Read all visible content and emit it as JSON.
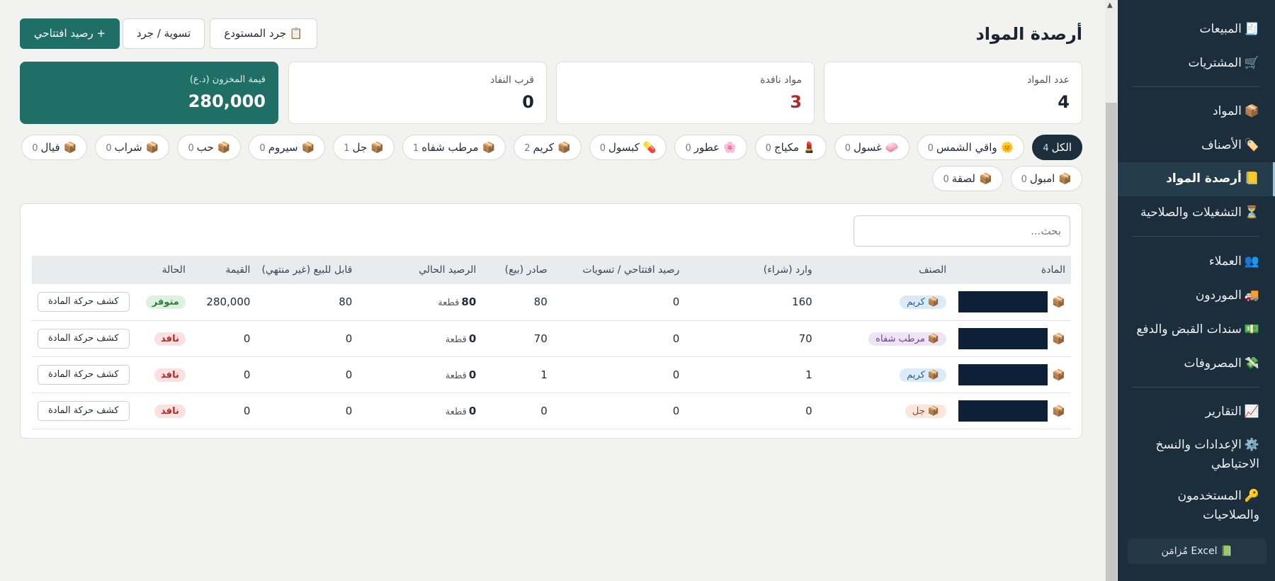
{
  "header": {
    "title": "أرصدة المواد",
    "buttons": {
      "warehouse_count": "📋 جرد المستودع",
      "settlement": "تسوية / جرد",
      "opening_balance": "+ رصيد افتتاحي"
    }
  },
  "stats": [
    {
      "label": "عدد المواد",
      "value": "4"
    },
    {
      "label": "مواد نافدة",
      "value": "3"
    },
    {
      "label": "قرب النفاد",
      "value": "0"
    },
    {
      "label": "قيمة المخزون (د.ع)",
      "value": "280,000"
    }
  ],
  "chips": [
    {
      "icon": "",
      "label": "الكل",
      "count": "4",
      "active": true
    },
    {
      "icon": "🌞",
      "label": "واقي الشمس",
      "count": "0"
    },
    {
      "icon": "🧼",
      "label": "غسول",
      "count": "0"
    },
    {
      "icon": "💄",
      "label": "مكياج",
      "count": "0"
    },
    {
      "icon": "🌸",
      "label": "عطور",
      "count": "0"
    },
    {
      "icon": "💊",
      "label": "كبسول",
      "count": "0"
    },
    {
      "icon": "📦",
      "label": "كريم",
      "count": "2"
    },
    {
      "icon": "📦",
      "label": "مرطب شفاه",
      "count": "1"
    },
    {
      "icon": "📦",
      "label": "جل",
      "count": "1"
    },
    {
      "icon": "📦",
      "label": "سيروم",
      "count": "0"
    },
    {
      "icon": "📦",
      "label": "حب",
      "count": "0"
    },
    {
      "icon": "📦",
      "label": "شراب",
      "count": "0"
    },
    {
      "icon": "📦",
      "label": "فيال",
      "count": "0"
    },
    {
      "icon": "📦",
      "label": "امبول",
      "count": "0"
    },
    {
      "icon": "📦",
      "label": "لصقة",
      "count": "0"
    }
  ],
  "search": {
    "placeholder": "بحث..."
  },
  "table": {
    "columns": [
      "المادة",
      "الصنف",
      "وارد (شراء)",
      "رصيد افتتاحي / تسويات",
      "صادر (بيع)",
      "الرصيد الحالي",
      "قابل للبيع (غير منتهي)",
      "القيمة",
      "الحالة",
      ""
    ],
    "unit": "قطعة",
    "action_label": "كشف حركة المادة",
    "rows": [
      {
        "category": "📦 كريم",
        "cat_color": "#dbeaf7",
        "cat_text": "#2a5d8f",
        "in": "160",
        "opening": "0",
        "out": "80",
        "balance": "80",
        "sellable": "80",
        "value": "280,000",
        "status": "متوفر",
        "status_bg": "#dcf1de",
        "status_fg": "#2e7d3a"
      },
      {
        "category": "📦 مرطب شفاه",
        "cat_color": "#efe3f6",
        "cat_text": "#6b3f8a",
        "in": "70",
        "opening": "0",
        "out": "70",
        "balance": "0",
        "sellable": "0",
        "value": "0",
        "status": "نافد",
        "status_bg": "#fbe0e0",
        "status_fg": "#b0282a"
      },
      {
        "category": "📦 كريم",
        "cat_color": "#dbeaf7",
        "cat_text": "#2a5d8f",
        "in": "1",
        "opening": "0",
        "out": "1",
        "balance": "0",
        "sellable": "0",
        "value": "0",
        "status": "نافد",
        "status_bg": "#fbe0e0",
        "status_fg": "#b0282a"
      },
      {
        "category": "📦 جل",
        "cat_color": "#fbe6dc",
        "cat_text": "#a2441d",
        "in": "0",
        "opening": "0",
        "out": "0",
        "balance": "0",
        "sellable": "0",
        "value": "0",
        "status": "نافد",
        "status_bg": "#fbe0e0",
        "status_fg": "#b0282a"
      }
    ]
  },
  "sidebar": {
    "items": [
      {
        "icon": "🧾",
        "label": "المبيعات"
      },
      {
        "icon": "🛒",
        "label": "المشتريات"
      },
      {
        "icon": "📦",
        "label": "المواد"
      },
      {
        "icon": "🏷️",
        "label": "الأصناف"
      },
      {
        "icon": "📒",
        "label": "أرصدة المواد"
      },
      {
        "icon": "⏳",
        "label": "التشغيلات والصلاحية"
      },
      {
        "icon": "👥",
        "label": "العملاء"
      },
      {
        "icon": "🚚",
        "label": "الموردون"
      },
      {
        "icon": "💵",
        "label": "سندات القبض والدفع"
      },
      {
        "icon": "💸",
        "label": "المصروفات"
      },
      {
        "icon": "📈",
        "label": "التقارير"
      },
      {
        "icon": "⚙️",
        "label": "الإعدادات والنسخ الاحتياطي"
      },
      {
        "icon": "🔑",
        "label": "المستخدمون والصلاحيات"
      }
    ],
    "excel": "📗 Excel مُزامَن"
  }
}
